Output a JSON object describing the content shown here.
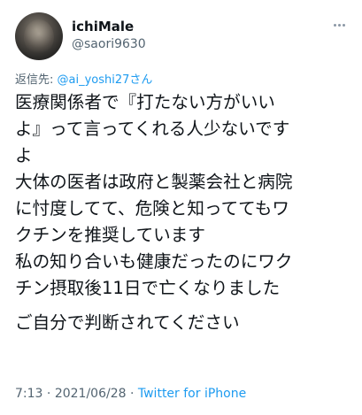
{
  "user": {
    "display_name": "ichiMale",
    "handle": "@saori9630"
  },
  "reply_to": {
    "prefix": "返信先: ",
    "mention": "@ai_yoshi27さん"
  },
  "tweet": {
    "lines": [
      "医療関係者で『打たない方がいい",
      "よ』って言ってくれる人少ないです",
      "よ",
      "大体の医者は政府と製薬会社と病院",
      "に忖度してて、危険と知っててもワ",
      "クチンを推奨しています",
      "私の知り合いも健康だったのにワク",
      "チン摂取後11日で亡くなりました",
      "ご自分で判断されてください"
    ]
  },
  "meta": {
    "time": "7:13",
    "separator1": " · ",
    "date": "2021/06/28",
    "separator2": " · ",
    "source": "Twitter for iPhone"
  },
  "icons": {
    "more": "more-horizontal-icon"
  },
  "colors": {
    "link": "#1d9bf0",
    "secondary_text": "#536471",
    "primary_text": "#0f1419"
  }
}
